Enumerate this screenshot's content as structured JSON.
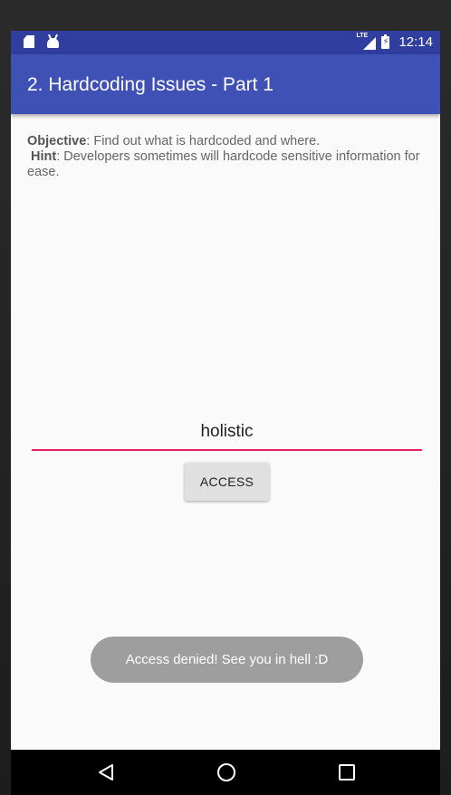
{
  "status_bar": {
    "time": "12:14",
    "network_label": "LTE",
    "icons": [
      "sd-card-icon",
      "android-icon",
      "lte-signal-icon",
      "battery-charging-icon"
    ]
  },
  "app_bar": {
    "title": "2. Hardcoding Issues - Part 1",
    "color": "#3f51b5"
  },
  "content": {
    "objective_label": "Objective",
    "objective_text": ": Find out what is hardcoded and where.",
    "hint_label": "Hint",
    "hint_text": ": Developers sometimes will hardcode sensitive information for ease."
  },
  "input": {
    "value": "holistic",
    "accent_color": "#e91e63"
  },
  "access_button": {
    "label": "ACCESS"
  },
  "toast": {
    "message": "Access denied! See you in hell :D"
  },
  "nav_bar": {
    "icons": [
      "back-icon",
      "home-icon",
      "recents-icon"
    ]
  }
}
